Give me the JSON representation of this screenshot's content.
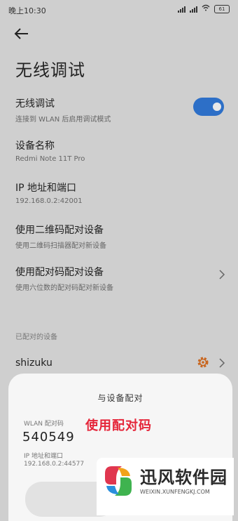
{
  "status_bar": {
    "time": "晚上10:30",
    "battery": "61"
  },
  "page": {
    "title": "无线调试"
  },
  "settings": [
    {
      "title": "无线调试",
      "subtitle": "连接到 WLAN 后启用调试模式",
      "toggle_on": true
    },
    {
      "title": "设备名称",
      "subtitle": "Redmi Note 11T Pro"
    },
    {
      "title": "IP 地址和端口",
      "subtitle": "192.168.0.2:42001"
    },
    {
      "title": "使用二维码配对设备",
      "subtitle": "使用二维码扫描器配对新设备"
    },
    {
      "title": "使用配对码配对设备",
      "subtitle": "使用六位数的配对码配对新设备"
    }
  ],
  "paired": {
    "section_label": "已配对的设备",
    "device_name": "shizuku"
  },
  "dialog": {
    "title": "与设备配对",
    "code_label": "WLAN 配对码",
    "code": "540549",
    "ip_label": "IP 地址和端口",
    "ip_value": "192.168.0.2:44577",
    "annotation": "使用配对码"
  },
  "watermark": {
    "name": "迅风软件园",
    "url": "WEIXIN.XUNFENGKJ.COM"
  },
  "colors": {
    "accent": "#2d6fc7",
    "annotation_red": "#e5263a",
    "gear_orange": "#c8661f"
  }
}
